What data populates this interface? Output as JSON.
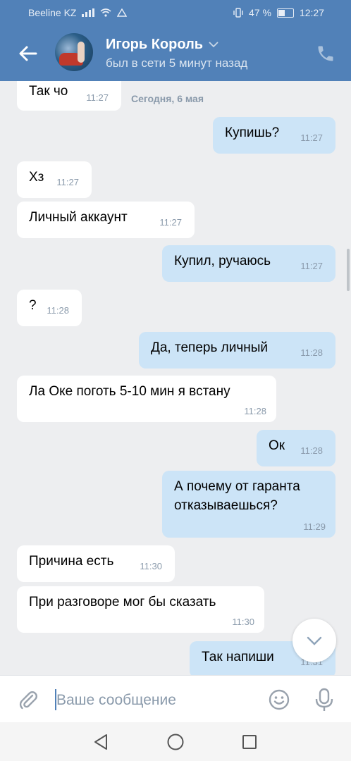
{
  "status_bar": {
    "carrier": "Beeline KZ",
    "battery": "47 %",
    "time": "12:27"
  },
  "header": {
    "name": "Игорь Король",
    "status": "был в сети 5 минут назад"
  },
  "chat": {
    "date_label": "Сегодня, 6 мая",
    "messages": [
      {
        "dir": "in",
        "lines": [
          "Так чо"
        ],
        "time": "11:27"
      },
      {
        "dir": "out",
        "lines": [
          "Купишь?"
        ],
        "time": "11:27"
      },
      {
        "dir": "in",
        "lines": [
          "Хз"
        ],
        "time": "11:27"
      },
      {
        "dir": "in",
        "lines": [
          "Личный аккаунт"
        ],
        "time": "11:27"
      },
      {
        "dir": "out",
        "lines": [
          "Купил, ручаюсь"
        ],
        "time": "11:27"
      },
      {
        "dir": "in",
        "lines": [
          "?"
        ],
        "time": "11:28"
      },
      {
        "dir": "out",
        "lines": [
          "Да, теперь личный"
        ],
        "time": "11:28"
      },
      {
        "dir": "in",
        "lines": [
          "Ла Оке поготь 5-10 мин я встану"
        ],
        "time": "11:28"
      },
      {
        "dir": "out",
        "lines": [
          "Ок"
        ],
        "time": "11:28"
      },
      {
        "dir": "out",
        "lines": [
          "А почему от гаранта",
          "отказываешься?"
        ],
        "time": "11:29"
      },
      {
        "dir": "in",
        "lines": [
          "Причина есть"
        ],
        "time": "11:30"
      },
      {
        "dir": "in",
        "lines": [
          "При разговоре мог бы сказать"
        ],
        "time": "11:30"
      },
      {
        "dir": "out",
        "lines": [
          "Так напиши"
        ],
        "time": "11:31"
      }
    ]
  },
  "composer": {
    "placeholder": "Ваше сообщение",
    "value": ""
  },
  "icons": {
    "back": "arrow-left-icon",
    "call": "phone-icon",
    "attach": "paperclip-icon",
    "emoji": "smiley-icon",
    "mic": "microphone-icon",
    "scroll_down": "chevron-down-icon",
    "nav_back": "triangle-back-icon",
    "nav_home": "circle-home-icon",
    "nav_recents": "square-recents-icon"
  },
  "colors": {
    "header": "#5181b8",
    "outgoing_bubble": "#cce4f7",
    "incoming_bubble": "#ffffff",
    "chat_background": "#edeef0"
  }
}
